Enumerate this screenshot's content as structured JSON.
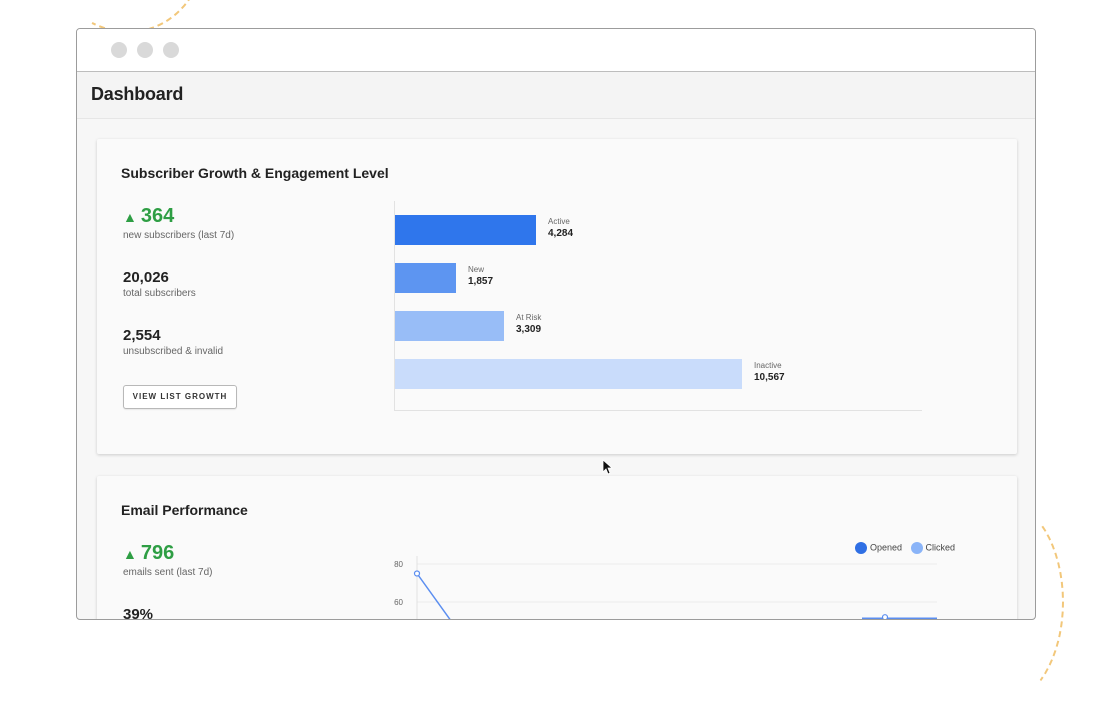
{
  "page_title": "Dashboard",
  "subscriber_card": {
    "title": "Subscriber Growth & Engagement Level",
    "stats": [
      {
        "value": "364",
        "label": "new subscribers (last 7d)"
      },
      {
        "value": "20,026",
        "label": "total subscribers"
      },
      {
        "value": "2,554",
        "label": "unsubscribed & invalid"
      }
    ],
    "button_label": "VIEW LIST GROWTH",
    "positive_color": "#2e9e44",
    "trend_icon": "up-triangle-icon"
  },
  "email_card": {
    "title": "Email Performance",
    "stats": [
      {
        "value": "796",
        "label": "emails sent (last 7d)"
      },
      {
        "value": "39%"
      }
    ],
    "legend": [
      {
        "name": "Opened",
        "color": "#2f6fe4"
      },
      {
        "name": "Clicked",
        "color": "#8ab4f8"
      }
    ]
  },
  "chart_data": [
    {
      "type": "bar",
      "orientation": "horizontal",
      "categories": [
        "Active",
        "New",
        "At Risk",
        "Inactive"
      ],
      "values": [
        4284,
        1857,
        3309,
        10567
      ],
      "value_labels": [
        "4,284",
        "1,857",
        "3,309",
        "10,567"
      ],
      "colors": [
        "#2f76ec",
        "#5d95f1",
        "#98bdf7",
        "#c9dcfb"
      ],
      "grid": false
    },
    {
      "type": "line",
      "ytick_labels": [
        "80",
        "60"
      ],
      "ylim": [
        40,
        80
      ],
      "series": [
        {
          "name": "Opened",
          "values": [
            75,
            52
          ]
        },
        {
          "name": "Clicked",
          "values": [
            51,
            52
          ]
        }
      ],
      "grid": true,
      "legend_position": "top-right"
    }
  ]
}
